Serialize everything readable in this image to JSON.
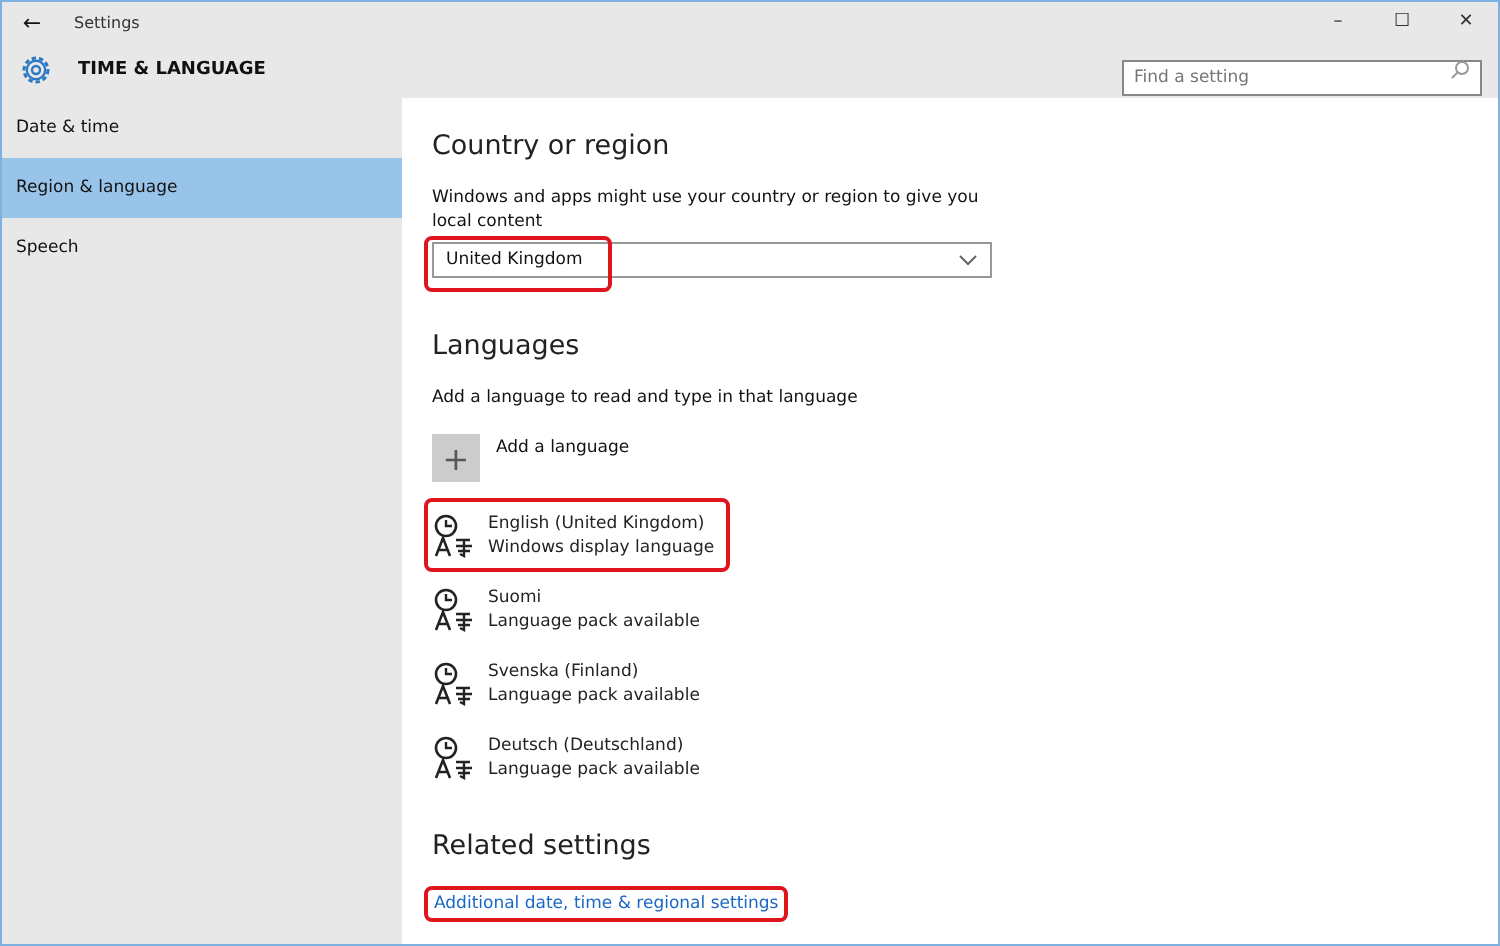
{
  "window": {
    "title": "Settings",
    "back": "←",
    "controls": [
      "–",
      "☐",
      "✕"
    ]
  },
  "header": {
    "title": "TIME & LANGUAGE",
    "search": {
      "placeholder": "Find a setting"
    }
  },
  "sidebar": {
    "items": [
      {
        "label": "Date & time",
        "selected": false
      },
      {
        "label": "Region & language",
        "selected": true
      },
      {
        "label": "Speech",
        "selected": false
      }
    ]
  },
  "country": {
    "heading": "Country or region",
    "description": "Windows and apps might use your country or region to give you local content",
    "value": "United Kingdom",
    "highlighted": true
  },
  "languages": {
    "heading": "Languages",
    "description": "Add a language to read and type in that language",
    "add_button": {
      "icon": "+",
      "label": "Add a language"
    },
    "items": [
      {
        "name": "English (United Kingdom)",
        "status": "Windows display language",
        "highlighted": true
      },
      {
        "name": "Suomi",
        "status": "Language pack available",
        "highlighted": false
      },
      {
        "name": "Svenska (Finland)",
        "status": "Language pack available",
        "highlighted": false
      },
      {
        "name": "Deutsch (Deutschland)",
        "status": "Language pack available",
        "highlighted": false
      }
    ]
  },
  "related": {
    "heading": "Related settings",
    "link": "Additional date, time & regional settings",
    "highlighted": true
  }
}
